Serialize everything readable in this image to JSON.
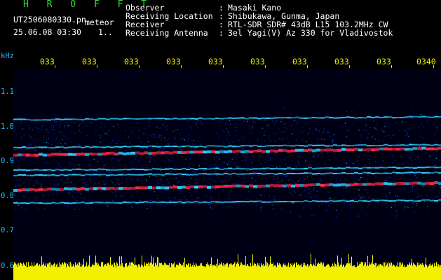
{
  "header": {
    "station": "H R O F F T",
    "filename": "UT2506080330.pn",
    "type": "meteor",
    "datetime": "25.06.08 03:30",
    "count": "1.."
  },
  "info": [
    {
      "key": "Observer",
      "sep": ":",
      "value": "Masaki Kano"
    },
    {
      "key": "Receiving Location",
      "sep": ":",
      "value": "Shibukawa, Gunma, Japan"
    },
    {
      "key": "Receiver",
      "sep": ":",
      "value": "RTL-SDR SDR# 43dB L15 103.2MHz CW"
    },
    {
      "key": "Receiving Antenna",
      "sep": ":",
      "value": "3el Yagi(V) Az 330 for Vladivostok"
    }
  ],
  "axes": {
    "y_unit": "kHz",
    "y_ticks": [
      "1.1",
      "1.0",
      "0.9",
      "0.8",
      "0.7",
      "0.6"
    ],
    "x_ticks": [
      "033",
      "033",
      "033",
      "033",
      "033",
      "033",
      "033",
      "033",
      "033",
      "0340"
    ]
  },
  "spectrogram": {
    "freq_range_khz": [
      0.6,
      1.15
    ],
    "bands_khz": [
      1.02,
      0.94,
      0.92,
      0.875,
      0.86,
      0.82,
      0.78
    ],
    "colors": {
      "background": "#000014",
      "noise": "#1a3cff",
      "band": "#2fd0ff",
      "strong": "#ff2a4a",
      "signal_bar": "#f0f000"
    }
  }
}
